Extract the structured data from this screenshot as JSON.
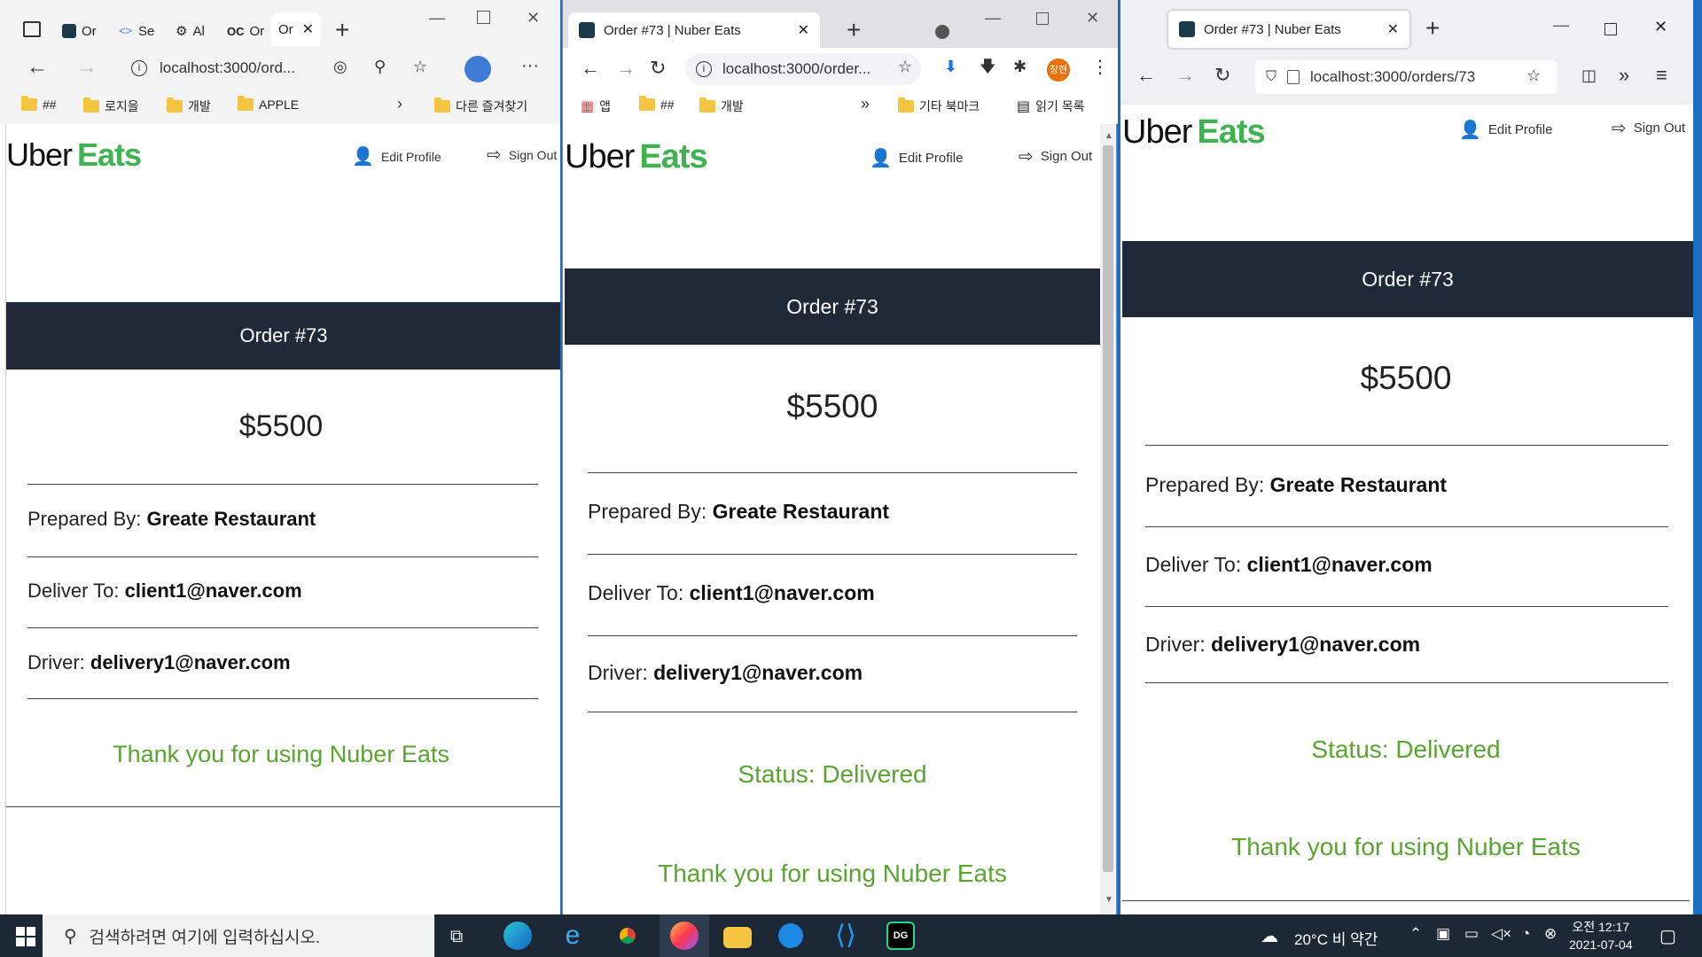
{
  "windows": [
    {
      "browser": "Edge",
      "tabs": [
        "Or",
        "Se",
        "Al",
        "Or",
        "Or"
      ],
      "address": "localhost:3000/ord...",
      "bookmarks": [
        "##",
        "로지을",
        "개발",
        "APPLE",
        "다른 즐겨찾기"
      ],
      "page": {
        "logo_part1": "Uber",
        "logo_part2": "Eats",
        "edit_profile": "Edit Profile",
        "sign_out": "Sign Out",
        "order_title": "Order #73",
        "price": "$5500",
        "prepared_label": "Prepared By: ",
        "prepared_value": "Greate Restaurant",
        "deliver_label": "Deliver To: ",
        "deliver_value": "client1@naver.com",
        "driver_label": "Driver: ",
        "driver_value": "delivery1@naver.com",
        "thanks": "Thank you for using Nuber Eats"
      }
    },
    {
      "browser": "Chrome",
      "tab_title": "Order #73 | Nuber Eats",
      "address": "localhost:3000/order...",
      "profile_badge": "창현",
      "bookmarks": [
        "앱",
        "##",
        "개발",
        "기타 북마크",
        "읽기 목록"
      ],
      "page": {
        "logo_part1": "Uber",
        "logo_part2": "Eats",
        "edit_profile": "Edit Profile",
        "sign_out": "Sign Out",
        "order_title": "Order #73",
        "price": "$5500",
        "prepared_label": "Prepared By: ",
        "prepared_value": "Greate Restaurant",
        "deliver_label": "Deliver To: ",
        "deliver_value": "client1@naver.com",
        "driver_label": "Driver: ",
        "driver_value": "delivery1@naver.com",
        "status": "Status: Delivered",
        "thanks": "Thank you for using Nuber Eats"
      }
    },
    {
      "browser": "Firefox",
      "tab_title": "Order #73 | Nuber Eats",
      "address": "localhost:3000/orders/73",
      "page": {
        "logo_part1": "Uber",
        "logo_part2": "Eats",
        "edit_profile": "Edit Profile",
        "sign_out": "Sign Out",
        "order_title": "Order #73",
        "price": "$5500",
        "prepared_label": "Prepared By: ",
        "prepared_value": "Greate Restaurant",
        "deliver_label": "Deliver To: ",
        "deliver_value": "client1@naver.com",
        "driver_label": "Driver: ",
        "driver_value": "delivery1@naver.com",
        "status": "Status: Delivered",
        "thanks": "Thank you for using Nuber Eats"
      }
    }
  ],
  "taskbar": {
    "search_placeholder": "검색하려면 여기에 입력하십시오.",
    "weather": "20°C  비 약간",
    "time": "오전 12:17",
    "date": "2021-07-04"
  },
  "colors": {
    "header_band": "#1f2937",
    "status_green": "#5aa531",
    "logo_green": "#3fb34f",
    "taskbar": "#1d2837"
  }
}
